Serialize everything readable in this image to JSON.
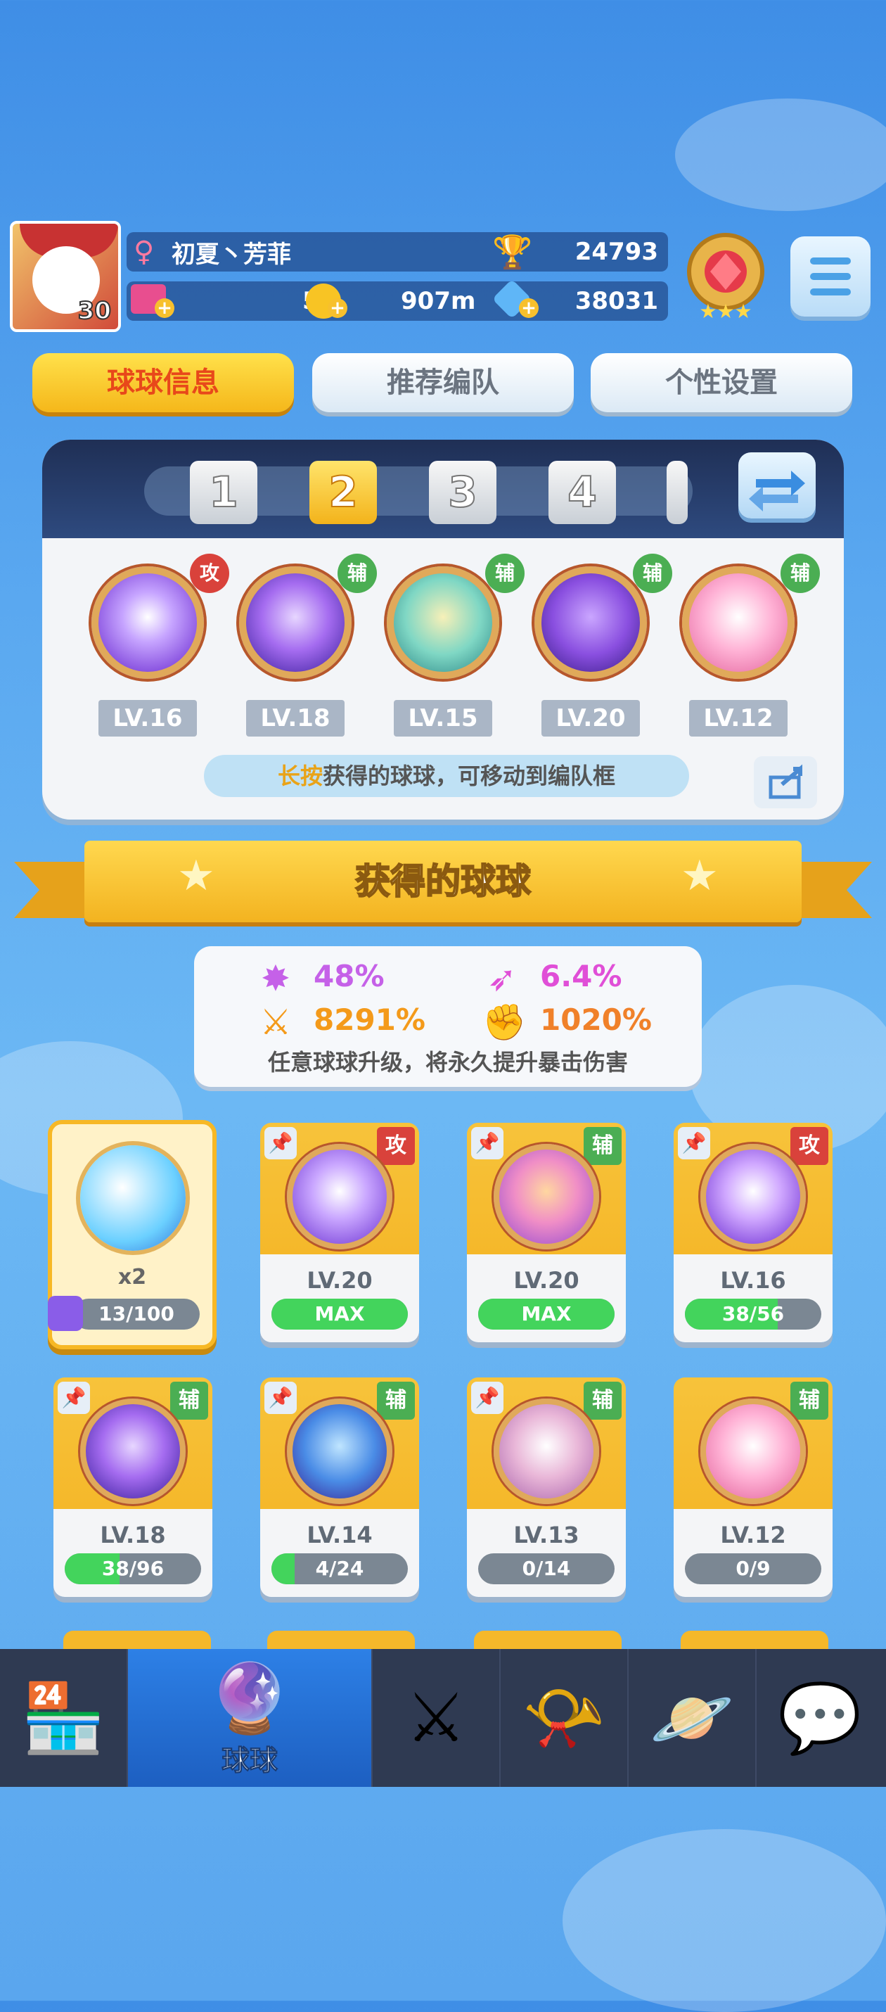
{
  "profile": {
    "name": "初夏丶芳菲",
    "level": "30",
    "trophies": "24793",
    "tickets": "59",
    "coins": "907m",
    "gems": "38031"
  },
  "tabs": [
    {
      "label": "球球信息"
    },
    {
      "label": "推荐编队"
    },
    {
      "label": "个性设置"
    }
  ],
  "team": {
    "slots": [
      "1",
      "2",
      "3",
      "4"
    ],
    "active_slot": "2",
    "balls": [
      {
        "role": "攻",
        "level": "LV.16"
      },
      {
        "role": "辅",
        "level": "LV.18"
      },
      {
        "role": "辅",
        "level": "LV.15"
      },
      {
        "role": "辅",
        "level": "LV.20"
      },
      {
        "role": "辅",
        "level": "LV.12"
      }
    ],
    "hint_highlight": "长按",
    "hint_text": "获得的球球，可移动到编队框"
  },
  "section_title": "获得的球球",
  "stats": {
    "items": [
      {
        "icon": "crit-rate-icon",
        "value": "48%",
        "color": "#c561e8"
      },
      {
        "icon": "speed-icon",
        "value": "6.4%",
        "color": "#e04fd7"
      },
      {
        "icon": "crit-damage-icon",
        "value": "8291%",
        "color": "#f49a1a"
      },
      {
        "icon": "boss-damage-icon",
        "value": "1020%",
        "color": "#f0812a"
      }
    ],
    "note": "任意球球升级，将永久提升暴击伤害"
  },
  "special_card": {
    "multiplier": "x2",
    "progress": "13/100"
  },
  "cards": [
    {
      "role": "攻",
      "level": "LV.20",
      "progress": "MAX",
      "fill": 1.0
    },
    {
      "role": "辅",
      "level": "LV.20",
      "progress": "MAX",
      "fill": 1.0
    },
    {
      "role": "攻",
      "level": "LV.16",
      "progress": "38/56",
      "fill": 0.68
    },
    {
      "role": "辅",
      "level": "LV.18",
      "progress": "38/96",
      "fill": 0.4
    },
    {
      "role": "辅",
      "level": "LV.14",
      "progress": "4/24",
      "fill": 0.17
    },
    {
      "role": "辅",
      "level": "LV.13",
      "progress": "0/14",
      "fill": 0.0
    },
    {
      "role": "辅",
      "level": "LV.12",
      "progress": "0/9",
      "fill": 0.0
    }
  ],
  "nav": {
    "items": [
      {
        "name": "shop",
        "label": ""
      },
      {
        "name": "balls",
        "label": "球球"
      },
      {
        "name": "battle",
        "label": ""
      },
      {
        "name": "whistle",
        "label": ""
      },
      {
        "name": "planet",
        "label": ""
      },
      {
        "name": "messages",
        "label": ""
      }
    ]
  },
  "colors": {
    "accent": "#f5b71a",
    "attack": "#d9423b",
    "support": "#4bae53",
    "progress": "#43d45c"
  }
}
